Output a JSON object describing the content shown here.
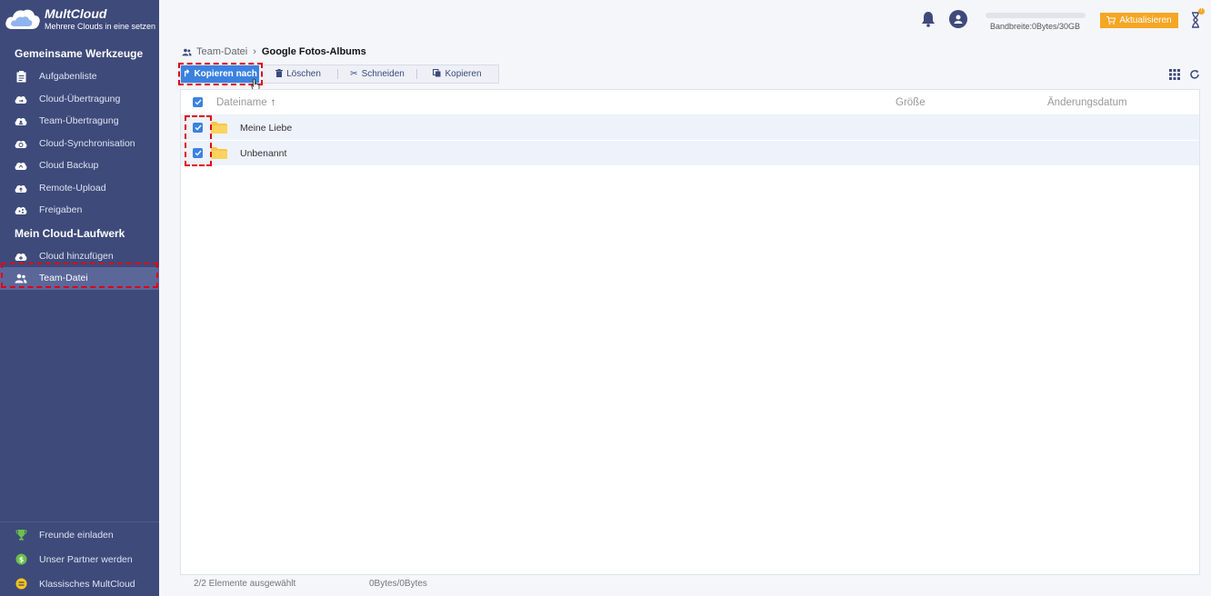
{
  "app": {
    "name": "MultCloud",
    "tagline": "Mehrere Clouds in eine setzen"
  },
  "sidebar": {
    "section1_title": "Gemeinsame Werkzeuge",
    "items": [
      {
        "label": "Aufgabenliste",
        "icon": "clipboard-icon"
      },
      {
        "label": "Cloud-Übertragung",
        "icon": "cloud-transfer-icon"
      },
      {
        "label": "Team-Übertragung",
        "icon": "team-transfer-icon"
      },
      {
        "label": "Cloud-Synchronisation",
        "icon": "cloud-sync-icon"
      },
      {
        "label": "Cloud Backup",
        "icon": "cloud-backup-icon"
      },
      {
        "label": "Remote-Upload",
        "icon": "remote-upload-icon"
      },
      {
        "label": "Freigaben",
        "icon": "share-icon"
      }
    ],
    "section2_title": "Mein Cloud-Laufwerk",
    "drive_items": [
      {
        "label": "Cloud hinzufügen",
        "icon": "cloud-add-icon"
      },
      {
        "label": "Team-Datei",
        "icon": "team-icon",
        "active": true
      }
    ],
    "bottom_items": [
      {
        "label": "Freunde einladen",
        "icon": "trophy-icon"
      },
      {
        "label": "Unser Partner werden",
        "icon": "dollar-icon"
      },
      {
        "label": "Klassisches MultCloud",
        "icon": "classic-icon"
      }
    ]
  },
  "topbar": {
    "bandwidth": "Bandbreite:0Bytes/30GB",
    "bandwidth_used_fraction": 0,
    "upgrade_label": "Aktualisieren",
    "notification_badge": "!"
  },
  "breadcrumb": {
    "root": "Team-Datei",
    "current": "Google Fotos-Albums"
  },
  "toolbar": {
    "copy_to": "Kopieren nach",
    "delete": "Löschen",
    "cut": "Schneiden",
    "copy": "Kopieren"
  },
  "table": {
    "columns": {
      "name": "Dateiname",
      "size": "Größe",
      "date": "Änderungsdatum"
    },
    "rows": [
      {
        "name": "Meine Liebe",
        "size": "",
        "date": "",
        "selected": true
      },
      {
        "name": "Unbenannt",
        "size": "",
        "date": "",
        "selected": true
      }
    ]
  },
  "status": {
    "selected": "2/2 Elemente ausgewählt",
    "size": "0Bytes/0Bytes"
  },
  "colors": {
    "sidebar_bg": "#3e4a7a",
    "accent": "#3b82e0",
    "upgrade": "#f5a623",
    "highlight_dash": "#e0001a"
  }
}
